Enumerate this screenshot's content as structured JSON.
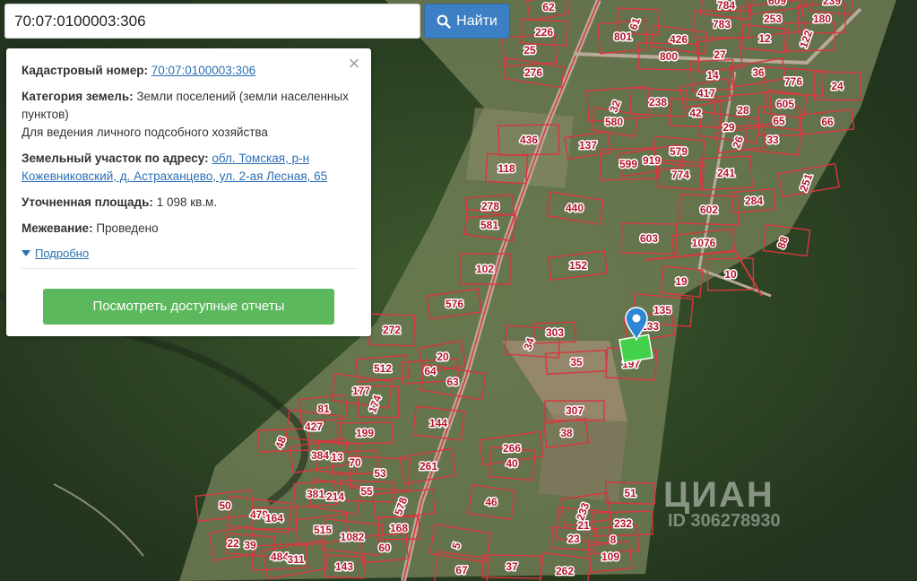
{
  "search": {
    "value": "70:07:0100003:306",
    "button_label": "Найти",
    "button_color": "#3c7fc4"
  },
  "info_panel": {
    "cadastral_label": "Кадастровый номер:",
    "cadastral_number": "70:07:0100003:306",
    "category_label": "Категория земель:",
    "category_value": "Земли поселений (земли населенных пунктов)",
    "usage": "Для ведения личного подсобного хозяйства",
    "address_label": "Земельный участок по адресу:",
    "address_line1": "обл. Томская, р-н",
    "address_line2": "Кожевниковский, д. Астраханцево, ул. 2-ая Лесная, 65",
    "area_label": "Уточненная площадь:",
    "area_value": "1 098 кв.м.",
    "survey_label": "Межевание:",
    "survey_value": "Проведено",
    "more_label": "Подробно",
    "reports_button": "Посмотреть доступные отчеты",
    "reports_button_color": "#5cb85c"
  },
  "map": {
    "boundary_color": "#d9363e",
    "highlight_color": "#3ddc4a",
    "marker_color": "#2b87d4",
    "watermark": "ЦИАН",
    "watermark_id": "ID 306278930",
    "plot_labels": [
      "62",
      "226",
      "25",
      "276",
      "61",
      "801",
      "426",
      "800",
      "27",
      "784",
      "783",
      "253",
      "12",
      "122",
      "609",
      "239",
      "180",
      "36",
      "776",
      "14",
      "417",
      "238",
      "32",
      "580",
      "42",
      "28",
      "605",
      "24",
      "66",
      "29",
      "65",
      "26",
      "33",
      "436",
      "137",
      "579",
      "599",
      "919",
      "774",
      "241",
      "251",
      "118",
      "278",
      "440",
      "602",
      "284",
      "581",
      "603",
      "1076",
      "88",
      "102",
      "152",
      "19",
      "10",
      "576",
      "135",
      "303",
      "133",
      "34",
      "35",
      "20",
      "197",
      "64",
      "63",
      "272",
      "512",
      "177",
      "174",
      "81",
      "427",
      "307",
      "38",
      "144",
      "199",
      "266",
      "40",
      "48",
      "384",
      "13",
      "70",
      "261",
      "53",
      "381",
      "214",
      "55",
      "578",
      "46",
      "51",
      "50",
      "479",
      "164",
      "515",
      "1082",
      "168",
      "233",
      "21",
      "232",
      "22",
      "39",
      "484",
      "311",
      "23",
      "8",
      "5",
      "143",
      "60",
      "67",
      "37",
      "109",
      "262"
    ]
  }
}
